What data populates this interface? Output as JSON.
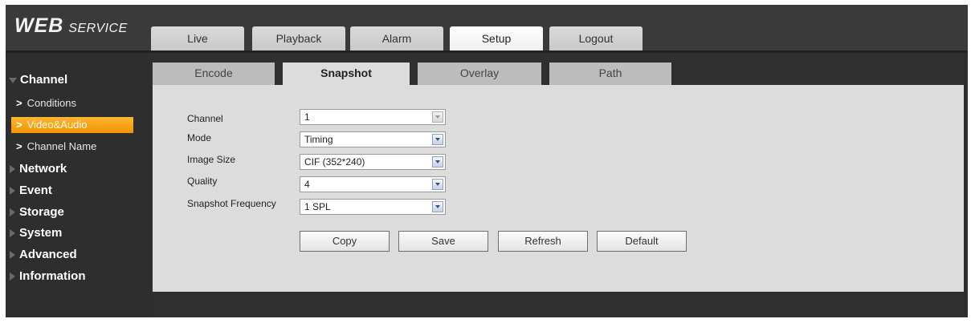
{
  "logo": {
    "main": "WEB",
    "sub": "SERVICE"
  },
  "main_tabs": [
    {
      "label": "Live"
    },
    {
      "label": "Playback"
    },
    {
      "label": "Alarm"
    },
    {
      "label": "Setup",
      "active": true
    },
    {
      "label": "Logout"
    }
  ],
  "sidebar": {
    "channel": "Channel",
    "sub_items": [
      {
        "label": "Conditions"
      },
      {
        "label": "Video&Audio",
        "active": true
      },
      {
        "label": "Channel Name"
      }
    ],
    "items": [
      {
        "label": "Network"
      },
      {
        "label": "Event"
      },
      {
        "label": "Storage"
      },
      {
        "label": "System"
      },
      {
        "label": "Advanced"
      },
      {
        "label": "Information"
      }
    ]
  },
  "sub_tabs": [
    {
      "label": "Encode"
    },
    {
      "label": "Snapshot",
      "active": true
    },
    {
      "label": "Overlay"
    },
    {
      "label": "Path"
    }
  ],
  "form": {
    "channel": {
      "label": "Channel",
      "value": "1"
    },
    "mode": {
      "label": "Mode",
      "value": "Timing"
    },
    "image_size": {
      "label": "Image Size",
      "value": "CIF (352*240)"
    },
    "quality": {
      "label": "Quality",
      "value": "4"
    },
    "frequency": {
      "label": "Snapshot Frequency",
      "value": "1 SPL"
    }
  },
  "buttons": {
    "copy": "Copy",
    "save": "Save",
    "refresh": "Refresh",
    "default": "Default"
  },
  "colors": {
    "accent": "#f39300",
    "sidebar_bg": "#2e2e2e",
    "content_bg": "#dcdcdc"
  }
}
